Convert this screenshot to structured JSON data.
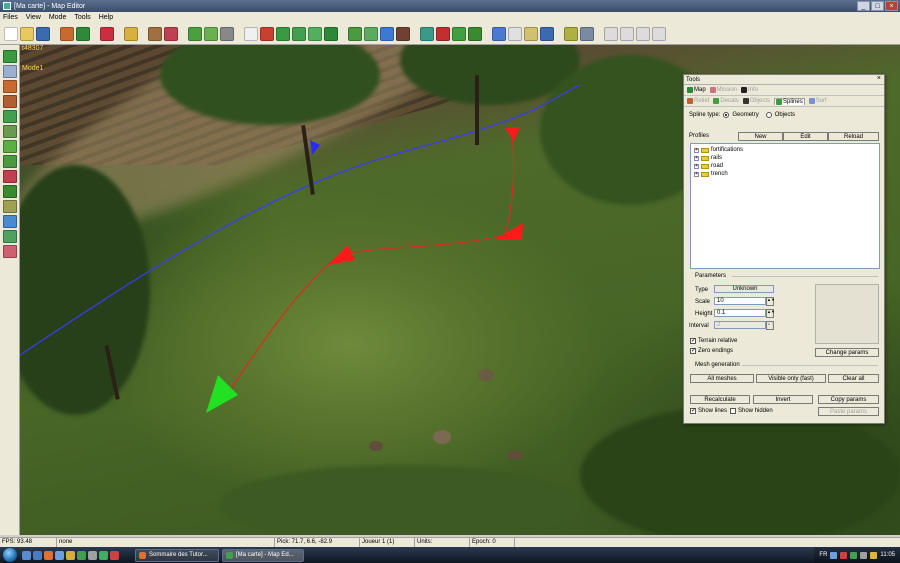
{
  "window": {
    "title": "[Ma carte] - Map Editor"
  },
  "menu": [
    "Files",
    "View",
    "Mode",
    "Tools",
    "Help"
  ],
  "viewport": {
    "fps_overlay": "t48307",
    "mode_label": "Mode1"
  },
  "tools_panel": {
    "title": "Tools",
    "close": "×",
    "main_tabs": [
      {
        "label": "Map",
        "active": true
      },
      {
        "label": "Mission",
        "active": false
      },
      {
        "label": "Info",
        "active": false
      }
    ],
    "sub_tabs": [
      {
        "label": "Relief",
        "active": false
      },
      {
        "label": "Decals",
        "active": false
      },
      {
        "label": "Objects",
        "active": false
      },
      {
        "label": "Splines",
        "active": true
      },
      {
        "label": "Surf",
        "active": false
      }
    ],
    "spline_type": {
      "label": "Spline type:",
      "options": [
        "Geometry",
        "Objects"
      ],
      "selected": "Geometry"
    },
    "profiles": {
      "label": "Profiles",
      "buttons": [
        "New",
        "Edit",
        "Reload"
      ],
      "items": [
        "fortifications",
        "rails",
        "road",
        "trench"
      ]
    },
    "parameters": {
      "title": "Parameters",
      "type_label": "Type",
      "type_value": "Unknown",
      "scale_label": "Scale",
      "scale_value": "10",
      "height_label": "Height",
      "height_value": "0.1",
      "interval_label": "Interval",
      "interval_value": "2",
      "terrain_relative": "Terrain relative",
      "zero_endings": "Zero endings",
      "change_params": "Change params"
    },
    "mesh": {
      "title": "Mesh generation",
      "all_meshes": "All meshes",
      "visible_only": "Visible only (fast)",
      "clear_all": "Clear all"
    },
    "actions": {
      "recalculate": "Recalculate",
      "invert": "Invert",
      "copy_params": "Copy params",
      "paste_params": "Paste params",
      "show_lines": "Show lines",
      "show_hidden": "Show hidden"
    }
  },
  "status": {
    "fps": "FPS: 93.48",
    "mode": "none",
    "pick": "Pick: 71.7, 6.6, -82.9",
    "player": "Joueur 1 (1)",
    "units": "Units:",
    "epoch": "Epoch: 0"
  },
  "taskbar": {
    "tasks": [
      {
        "label": "Sommaire des Tutor...",
        "active": false
      },
      {
        "label": "[Ma carte] - Map Ed...",
        "active": true
      }
    ],
    "lang": "FR",
    "clock": "11:05"
  },
  "colors": {
    "spline_line": "#d03020",
    "marker_red": "#ff1a1a",
    "marker_green": "#22e022",
    "road_line": "#3a3aff"
  }
}
